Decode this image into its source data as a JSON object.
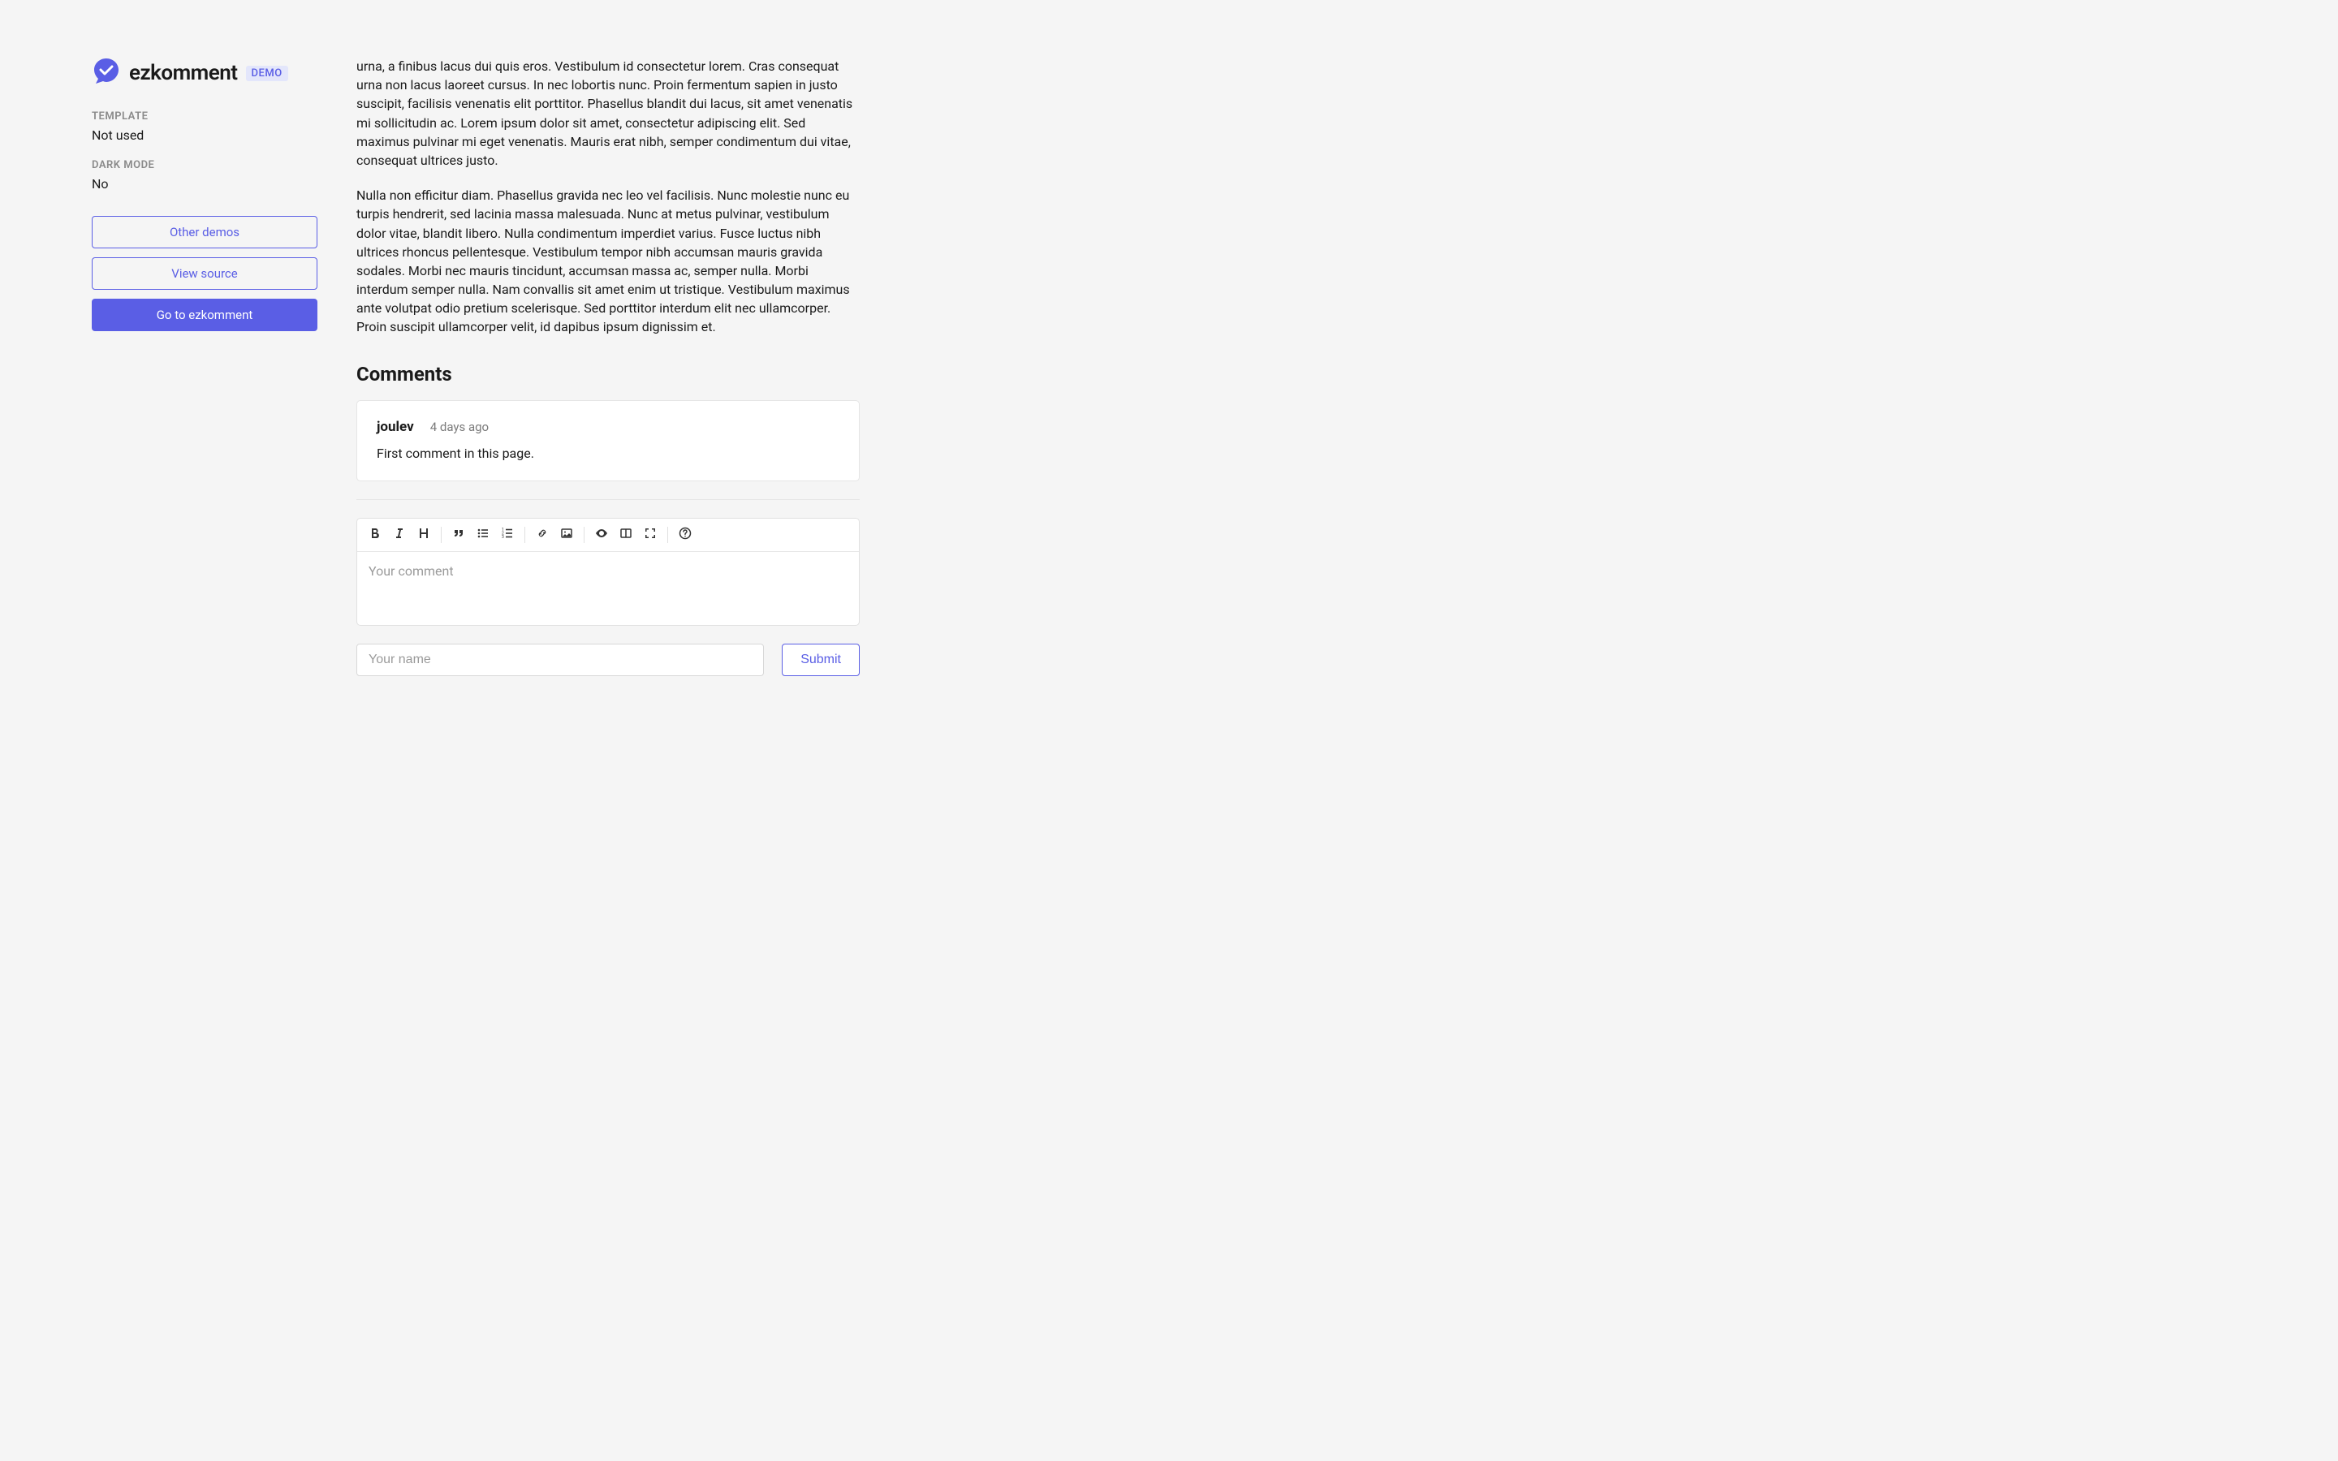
{
  "sidebar": {
    "app_name": "ezkomment",
    "demo_label": "DEMO",
    "meta": [
      {
        "label": "TEMPLATE",
        "value": "Not used"
      },
      {
        "label": "DARK MODE",
        "value": "No"
      }
    ],
    "buttons": {
      "other_demos": "Other demos",
      "view_source": "View source",
      "go_home": "Go to ezkomment"
    }
  },
  "body": {
    "para1": "urna, a finibus lacus dui quis eros. Vestibulum id consectetur lorem. Cras consequat urna non lacus laoreet cursus. In nec lobortis nunc. Proin fermentum sapien in justo suscipit, facilisis venenatis elit porttitor. Phasellus blandit dui lacus, sit amet venenatis mi sollicitudin ac. Lorem ipsum dolor sit amet, consectetur adipiscing elit. Sed maximus pulvinar mi eget venenatis. Mauris erat nibh, semper condimentum dui vitae, consequat ultrices justo.",
    "para2": "Nulla non efficitur diam. Phasellus gravida nec leo vel facilisis. Nunc molestie nunc eu turpis hendrerit, sed lacinia massa malesuada. Nunc at metus pulvinar, vestibulum dolor vitae, blandit libero. Nulla condimentum imperdiet varius. Fusce luctus nibh ultrices rhoncus pellentesque. Vestibulum tempor nibh accumsan mauris gravida sodales. Morbi nec mauris tincidunt, accumsan massa ac, semper nulla. Morbi interdum semper nulla. Nam convallis sit amet enim ut tristique. Vestibulum maximus ante volutpat odio pretium scelerisque. Sed porttitor interdum elit nec ullamcorper. Proin suscipit ullamcorper velit, id dapibus ipsum dignissim et."
  },
  "comments": {
    "heading": "Comments",
    "list": [
      {
        "author": "joulev",
        "time": "4 days ago",
        "body": "First comment in this page."
      }
    ]
  },
  "editor": {
    "placeholder": "Your comment",
    "name_placeholder": "Your name",
    "submit": "Submit"
  },
  "colors": {
    "primary": "#5a5ee5"
  }
}
